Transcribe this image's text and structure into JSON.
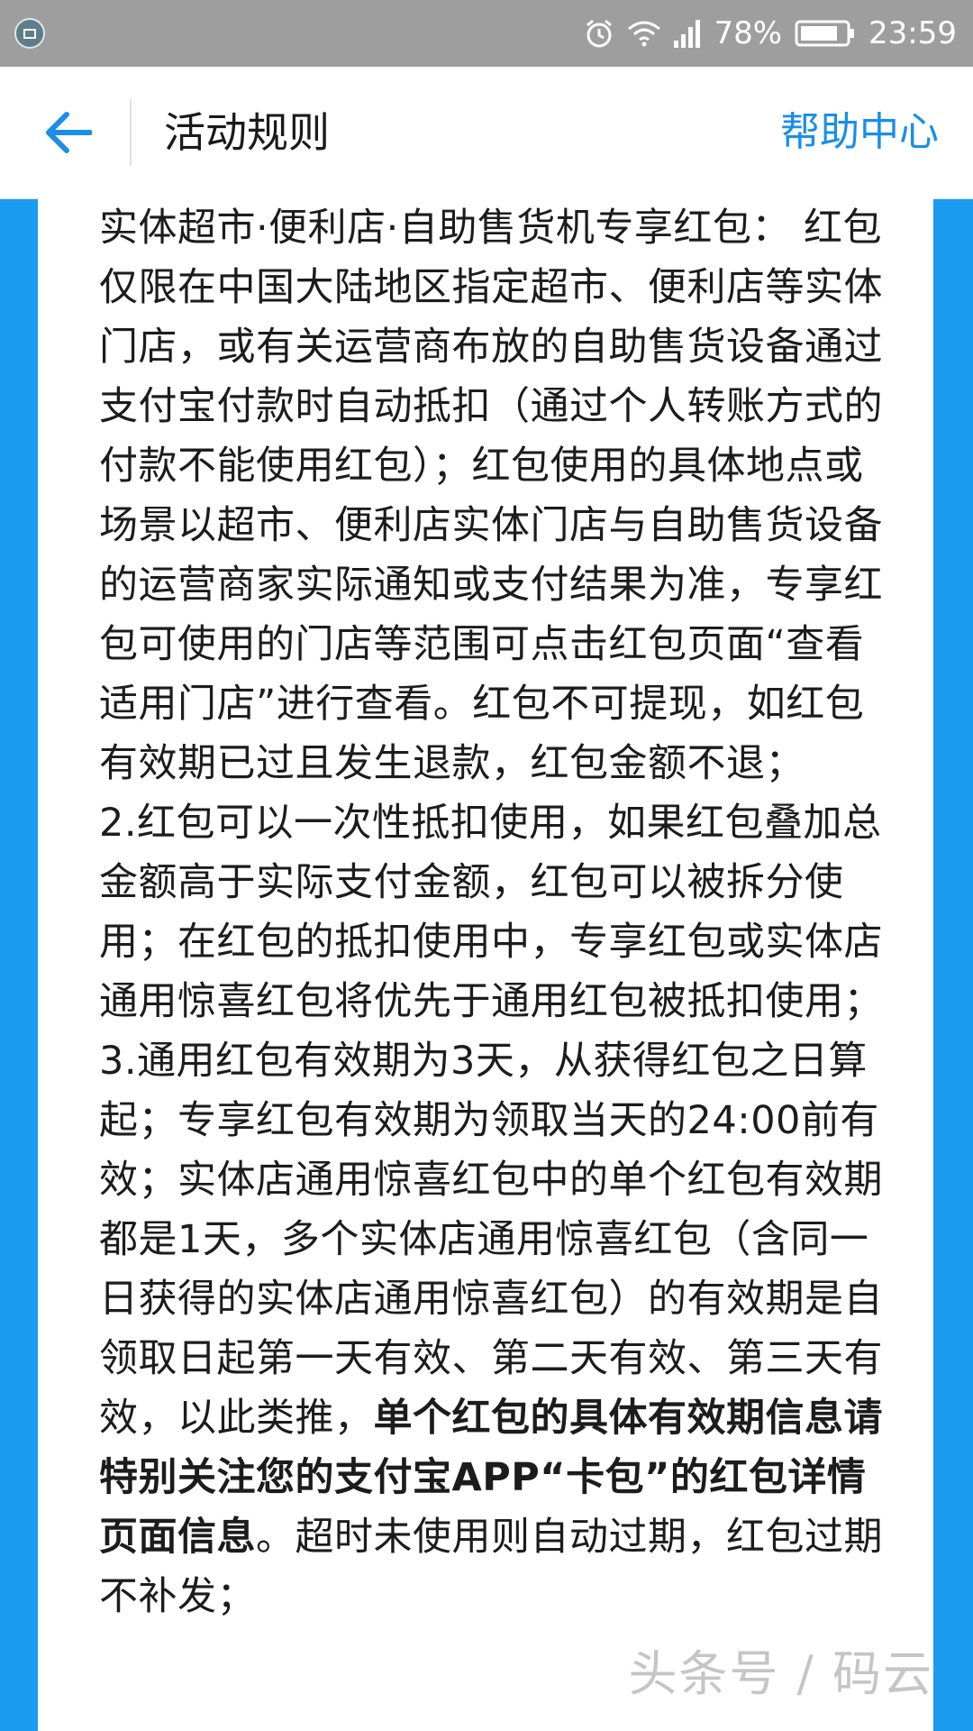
{
  "status_bar": {
    "battery_percent": "78%",
    "time": "23:59",
    "icons": [
      "notification-icon",
      "alarm-icon",
      "wifi-icon",
      "signal-icon",
      "battery-icon"
    ]
  },
  "app_bar": {
    "title": "活动规则",
    "help_link": "帮助中心",
    "back_icon": "arrow-left-icon"
  },
  "rules": {
    "paragraph_1": "实体超市·便利店·自助售货机专享红包： 红包仅限在中国大陆地区指定超市、便利店等实体门店，或有关运营商布放的自助售货设备通过支付宝付款时自动抵扣（通过个人转账方式的付款不能使用红包）；红包使用的具体地点或场景以超市、便利店实体门店与自助售货设备的运营商家实际通知或支付结果为准，专享红包可使用的门店等范围可点击红包页面“查看适用门店”进行查看。红包不可提现，如红包有效期已过且发生退款，红包金额不退；",
    "paragraph_2": "2.红包可以一次性抵扣使用，如果红包叠加总金额高于实际支付金额，红包可以被拆分使用；在红包的抵扣使用中，专享红包或实体店通用惊喜红包将优先于通用红包被抵扣使用；",
    "paragraph_3_start": "3.通用红包有效期为3天，从获得红包之日算起；专享红包有效期为领取当天的24:00前有效；实体店通用惊喜红包中的单个红包有效期都是1天，多个实体店通用惊喜红包（含同一日获得的实体店通用惊喜红包）的有效期是自领取日起第一天有效、第二天有效、第三天有效，以此类推，",
    "paragraph_3_bold": "单个红包的具体有效期信息请特别关注您的支付宝APP“卡包”的红包详情页面信息",
    "paragraph_3_end": "。超时未使用则自动过期，红包过期不补发；"
  },
  "watermark": "头条号 / 码云",
  "colors": {
    "accent_blue": "#1a8ee8",
    "background_blue": "#1a9cf0",
    "status_bar_gray": "#9e9e9e",
    "card_white": "#ffffff"
  }
}
